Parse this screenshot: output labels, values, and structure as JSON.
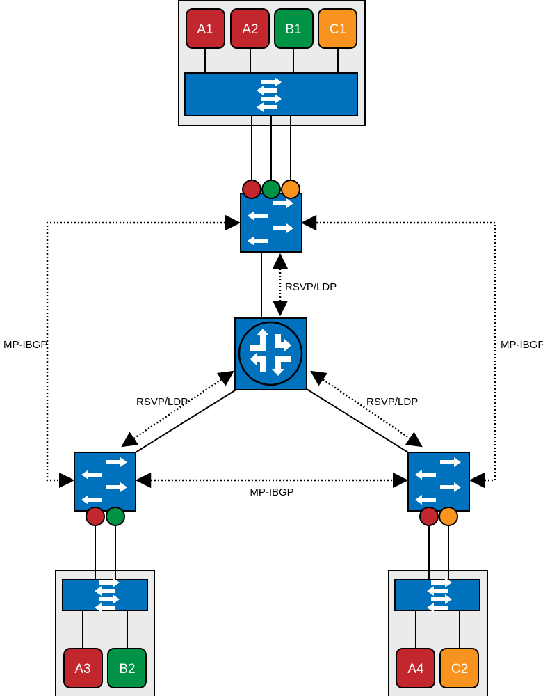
{
  "colors": {
    "red": "#c1272d",
    "green": "#009245",
    "orange": "#f7931e",
    "blue": "#0071bc",
    "site_bg": "#ebebeb"
  },
  "top_site": {
    "chips": [
      {
        "label": "A1",
        "color": "red"
      },
      {
        "label": "A2",
        "color": "red"
      },
      {
        "label": "B1",
        "color": "green"
      },
      {
        "label": "C1",
        "color": "orange"
      }
    ]
  },
  "bottom_left_site": {
    "chips": [
      {
        "label": "A3",
        "color": "red"
      },
      {
        "label": "B2",
        "color": "green"
      }
    ]
  },
  "bottom_right_site": {
    "chips": [
      {
        "label": "A4",
        "color": "red"
      },
      {
        "label": "C2",
        "color": "orange"
      }
    ]
  },
  "labels": {
    "rsvp_top": "RSVP/LDP",
    "rsvp_left": "RSVP/LDP",
    "rsvp_right": "RSVP/LDP",
    "mpibgp_left": "MP-IBGP",
    "mpibgp_right": "MP-IBGP",
    "mpibgp_bottom": "MP-IBGP"
  },
  "icons": {
    "pe": "switch-icon",
    "p": "router-icon"
  }
}
